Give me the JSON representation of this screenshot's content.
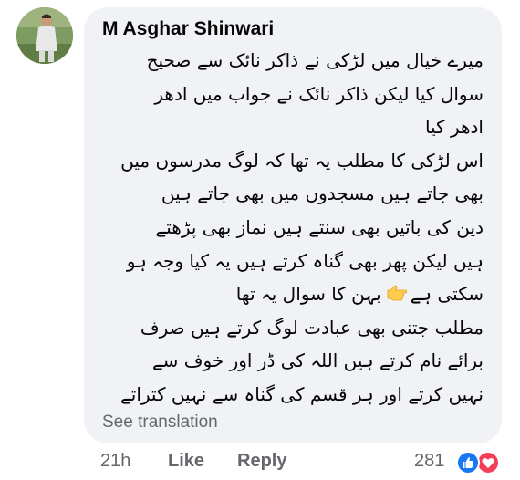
{
  "comment": {
    "author": "M Asghar Shinwari",
    "lines": [
      "میرے خیال میں لڑکی نے ذاکر نائک سے صحیح",
      "سوال کیا لیکن ذاکر نائک نے جواب میں ادھر",
      "ادھر کیا",
      "اس لڑکی کا مطلب یہ تھا کہ لوگ مدرسوں میں",
      "بھی جاتے ہیں مسجدوں میں بھی جاتے ہیں",
      "دین کی باتیں بھی سنتے ہیں نماز بھی پڑھتے",
      "ہیں لیکن پھر بھی گناہ کرتے ہیں یہ کیا وجہ ہو",
      "مطلب جتنی بھی عبادت لوگ کرتے ہیں صرف",
      "برائے نام کرتے ہیں اللہ کی ڈر اور خوف سے",
      "نہیں کرتے اور ہر قسم کی گناہ سے نہیں کتراتے"
    ],
    "line_with_emoji": {
      "before": "سکتی ہے",
      "after": "بہن کا سوال یہ تھا",
      "emoji": "pointing-hand-emoji"
    },
    "see_translation": "See translation"
  },
  "actions": {
    "time": "21h",
    "like": "Like",
    "reply": "Reply"
  },
  "reactions": {
    "count": "281",
    "types": [
      "like-reaction-icon",
      "love-reaction-icon"
    ]
  },
  "colors": {
    "bubble": "#f0f2f5",
    "text": "#050505",
    "secondary_text": "#65676b",
    "like_blue": "#1877f2",
    "love_red": "#f33e58"
  }
}
